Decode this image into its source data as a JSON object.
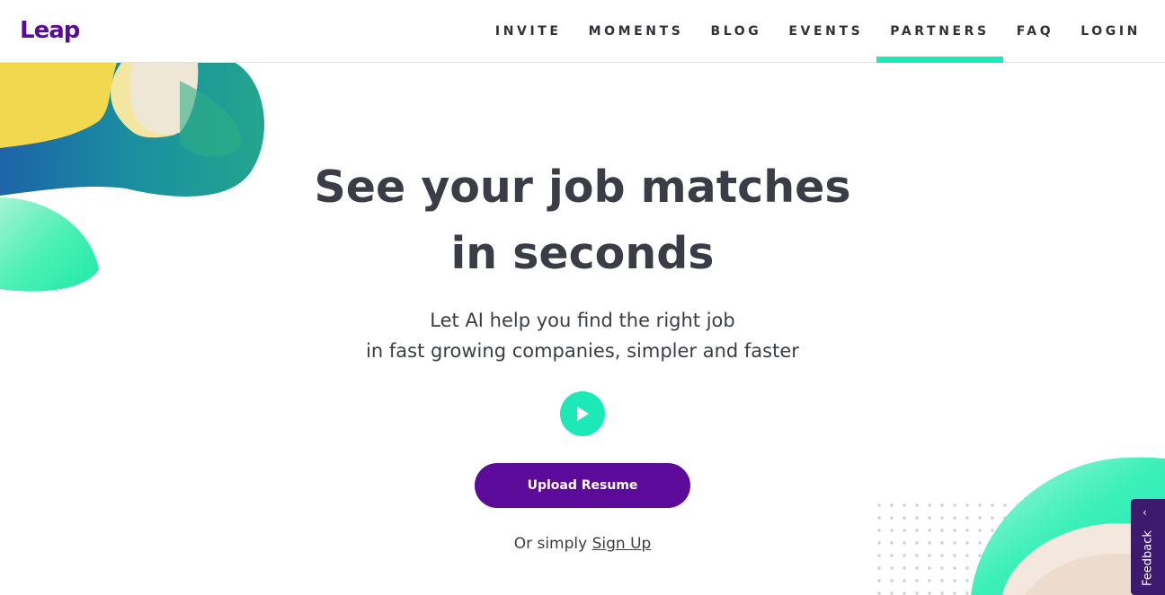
{
  "brand": {
    "logo_text": "Leap",
    "color": "#5b0a9a"
  },
  "accent_color": "#1de9b6",
  "nav": {
    "items": [
      {
        "label": "INVITE"
      },
      {
        "label": "MOMENTS"
      },
      {
        "label": "BLOG"
      },
      {
        "label": "EVENTS"
      },
      {
        "label": "PARTNERS",
        "active": true
      },
      {
        "label": "FAQ"
      },
      {
        "label": "LOGIN"
      }
    ]
  },
  "hero": {
    "title_line1": "See your job matches",
    "title_line2": "in seconds",
    "subtitle_line1": "Let AI help you find the right job",
    "subtitle_line2": "in fast growing companies, simpler and faster",
    "play_icon": "play-icon",
    "upload_label": "Upload Resume",
    "signup_prefix": "Or simply ",
    "signup_link": "Sign Up"
  },
  "feedback": {
    "label": "Feedback",
    "icon": "chevron-left-icon"
  }
}
